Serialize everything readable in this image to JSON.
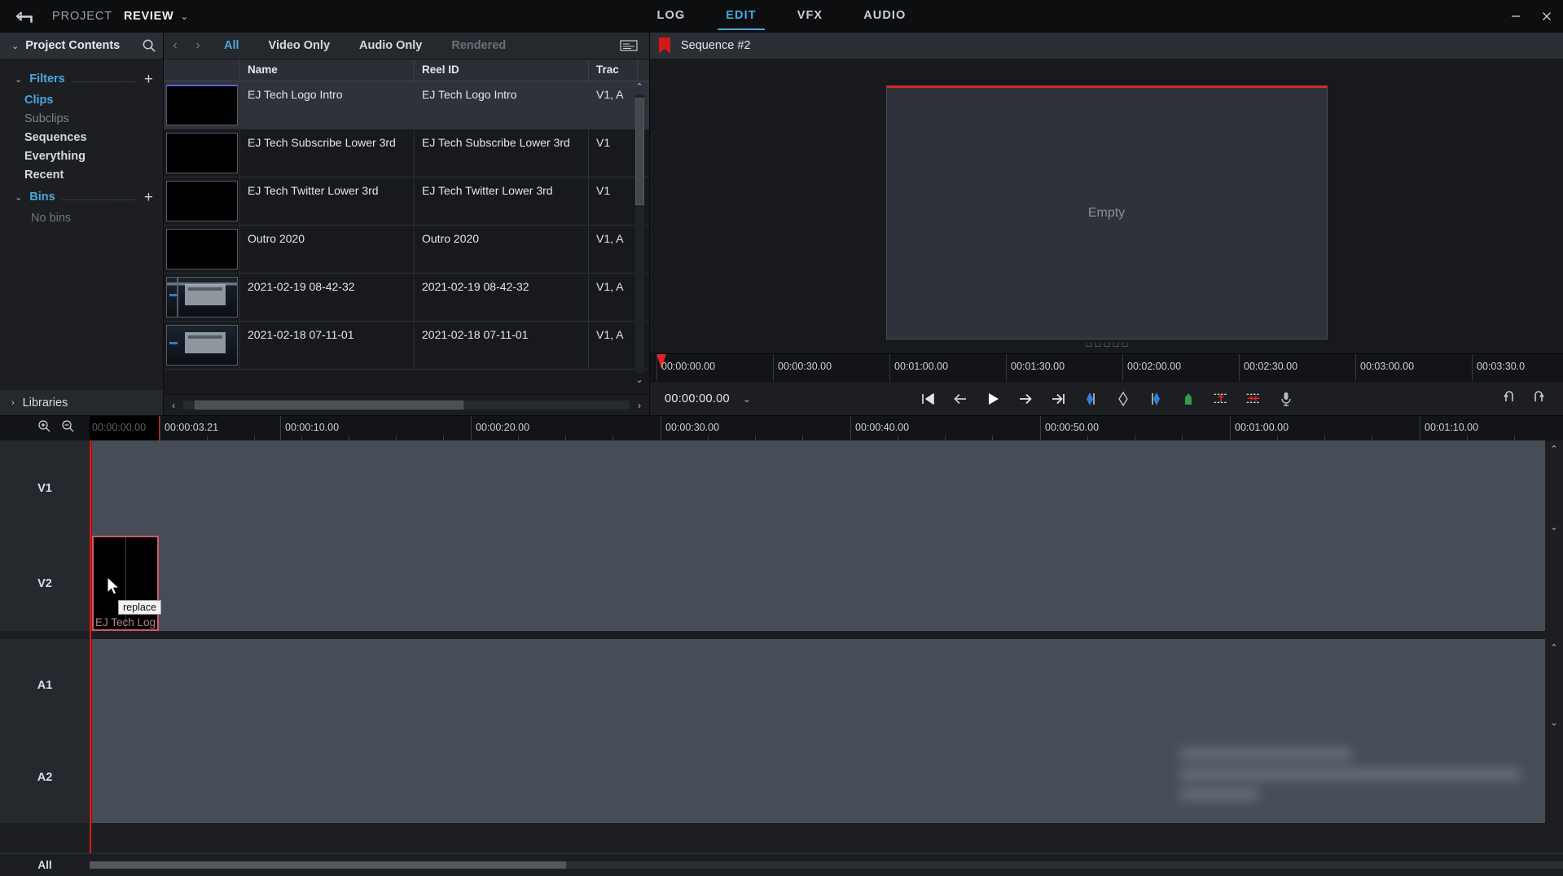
{
  "titlebar": {
    "back_icon": "back-arrow-icon",
    "project_label": "PROJECT",
    "review_label": "REVIEW",
    "caret": "⌄",
    "tabs": [
      {
        "label": "LOG",
        "active": false
      },
      {
        "label": "EDIT",
        "active": true
      },
      {
        "label": "VFX",
        "active": false
      },
      {
        "label": "AUDIO",
        "active": false
      }
    ],
    "window_buttons": [
      "minimize-button",
      "close-button"
    ],
    "accent_blue": "#4aa8e0"
  },
  "sidebar": {
    "header": {
      "title": "Project Contents",
      "chevron": "⌄",
      "search_icon": "search-icon"
    },
    "filters": {
      "label": "Filters",
      "chevron": "⌄",
      "add": "+"
    },
    "filter_items": [
      {
        "label": "Clips",
        "state": "selected"
      },
      {
        "label": "Subclips",
        "state": "dim"
      },
      {
        "label": "Sequences",
        "state": "normal"
      },
      {
        "label": "Everything",
        "state": "normal"
      },
      {
        "label": "Recent",
        "state": "normal"
      }
    ],
    "bins": {
      "label": "Bins",
      "chevron": "⌄",
      "add": "+"
    },
    "bins_empty": "No bins",
    "footer": {
      "label": "Libraries",
      "chevron": "›"
    }
  },
  "browser": {
    "nav_prev": "‹",
    "nav_next": "›",
    "filters": [
      {
        "label": "All",
        "active": true,
        "disabled": false
      },
      {
        "label": "Video Only",
        "active": false,
        "disabled": false
      },
      {
        "label": "Audio Only",
        "active": false,
        "disabled": false
      },
      {
        "label": "Rendered",
        "active": false,
        "disabled": true
      }
    ],
    "list_view_icon": "list-view-icon",
    "columns": [
      "",
      "Name",
      "Reel ID",
      "Trac"
    ],
    "rows": [
      {
        "name": "EJ Tech Logo Intro",
        "reel_id": "EJ Tech Logo Intro",
        "track": "V1, A",
        "selected": true,
        "thumb": "black"
      },
      {
        "name": "EJ Tech Subscribe Lower 3rd",
        "reel_id": "EJ Tech Subscribe Lower 3rd",
        "track": "V1",
        "selected": false,
        "thumb": "black"
      },
      {
        "name": "EJ Tech Twitter Lower 3rd",
        "reel_id": "EJ Tech Twitter Lower 3rd",
        "track": "V1",
        "selected": false,
        "thumb": "black"
      },
      {
        "name": "Outro 2020",
        "reel_id": "Outro 2020",
        "track": "V1, A",
        "selected": false,
        "thumb": "black"
      },
      {
        "name": "2021-02-19 08-42-32",
        "reel_id": "2021-02-19 08-42-32",
        "track": "V1, A",
        "selected": false,
        "thumb": "screen"
      },
      {
        "name": "2021-02-18 07-11-01",
        "reel_id": "2021-02-18 07-11-01",
        "track": "V1, A",
        "selected": false,
        "thumb": "screen"
      }
    ],
    "scroll_up": "⌃",
    "scroll_down": "⌄"
  },
  "viewer": {
    "flag_icon": "red-bookmark-icon",
    "title": "Sequence #2",
    "empty_label": "Empty",
    "ruler_ticks": [
      "00:00:00.00",
      "00:00:30.00",
      "00:01:00.00",
      "00:01:30.00",
      "00:02:00.00",
      "00:02:30.00",
      "00:03:00.00",
      "00:03:30.0"
    ],
    "timecode": "00:00:00.00",
    "timecode_caret": "⌄",
    "transport_buttons": [
      "go-to-start-icon",
      "step-back-icon",
      "play-icon",
      "step-forward-icon",
      "go-to-end-icon",
      "mark-in-icon",
      "mark-clip-icon",
      "mark-out-icon",
      "add-marker-icon",
      "insert-edit-icon",
      "overwrite-edit-icon",
      "voice-over-icon"
    ],
    "right_buttons": [
      "loop-icon",
      "loop-selection-icon"
    ]
  },
  "timeline": {
    "zoom_in_icon": "zoom-in-icon",
    "zoom_out_icon": "zoom-out-icon",
    "current_timecode": "00:00:00.00",
    "ruler_ticks": [
      "00:00:03.21",
      "00:00:10.00",
      "00:00:20.00",
      "00:00:30.00",
      "00:00:40.00",
      "00:00:50.00",
      "00:01:00.00",
      "00:01:10.00"
    ],
    "tracks": [
      {
        "label": "V1",
        "type": "video"
      },
      {
        "label": "V2",
        "type": "video"
      },
      {
        "label": "A1",
        "type": "audio"
      },
      {
        "label": "A2",
        "type": "audio"
      }
    ],
    "clip": {
      "track": "V2",
      "label": "EJ Tech Log",
      "selected": true
    },
    "tooltip": "replace",
    "cursor_icon": "mouse-pointer-icon",
    "all_label": "All",
    "scroll_up": "⌃",
    "scroll_down": "⌄"
  }
}
